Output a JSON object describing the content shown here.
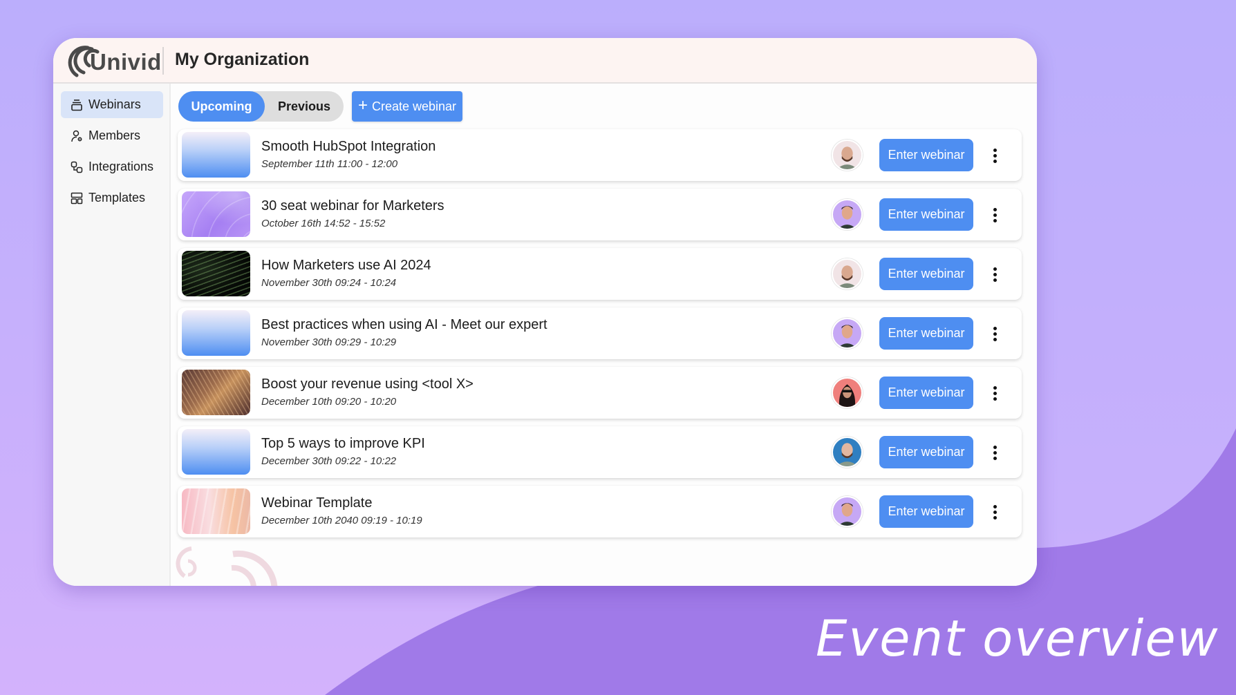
{
  "colors": {
    "accent": "#4e8ef1",
    "background_light": "#bcaefc",
    "background_dark": "#a07ae8",
    "header_bg": "#fdf4f2",
    "sidebar_active_bg": "#d9e4f8"
  },
  "header": {
    "logo_text": "Univid",
    "org_title": "My Organization"
  },
  "sidebar": {
    "items": [
      {
        "label": "Webinars",
        "icon": "webinars-icon",
        "active": true
      },
      {
        "label": "Members",
        "icon": "members-icon",
        "active": false
      },
      {
        "label": "Integrations",
        "icon": "integrations-icon",
        "active": false
      },
      {
        "label": "Templates",
        "icon": "templates-icon",
        "active": false
      }
    ]
  },
  "toolbar": {
    "tabs": [
      {
        "label": "Upcoming",
        "active": true
      },
      {
        "label": "Previous",
        "active": false
      }
    ],
    "create_icon": "+",
    "create_label": "Create webinar"
  },
  "webinars": [
    {
      "title": "Smooth HubSpot Integration",
      "date": "September 11th 11:00 - 12:00",
      "thumbnail": "blue-gradient",
      "host_avatar": "bald-man-beard",
      "action_label": "Enter webinar"
    },
    {
      "title": "30 seat webinar for Marketers",
      "date": "October 16th 14:52 - 15:52",
      "thumbnail": "purple-waves",
      "host_avatar": "young-man-lavender",
      "action_label": "Enter webinar"
    },
    {
      "title": "How Marketers use AI 2024",
      "date": "November 30th 09:24 - 10:24",
      "thumbnail": "dark-green-waves",
      "host_avatar": "bald-man-beard",
      "action_label": "Enter webinar"
    },
    {
      "title": "Best practices when using AI - Meet our expert",
      "date": "November 30th 09:29 - 10:29",
      "thumbnail": "blue-gradient",
      "host_avatar": "young-man-lavender",
      "action_label": "Enter webinar"
    },
    {
      "title": "Boost your revenue using <tool X>",
      "date": "December 10th 09:20 - 10:20",
      "thumbnail": "bronze-waves",
      "host_avatar": "woman-sunglasses-red",
      "action_label": "Enter webinar"
    },
    {
      "title": "Top 5 ways to improve KPI",
      "date": "December 30th 09:22 - 10:22",
      "thumbnail": "blue-gradient",
      "host_avatar": "bald-man-blue",
      "action_label": "Enter webinar"
    },
    {
      "title": "Webinar Template",
      "date": "December 10th 2040 09:19 - 10:19",
      "thumbnail": "peach-waves",
      "host_avatar": "young-man-lavender",
      "action_label": "Enter webinar"
    }
  ],
  "caption": "Event overview"
}
